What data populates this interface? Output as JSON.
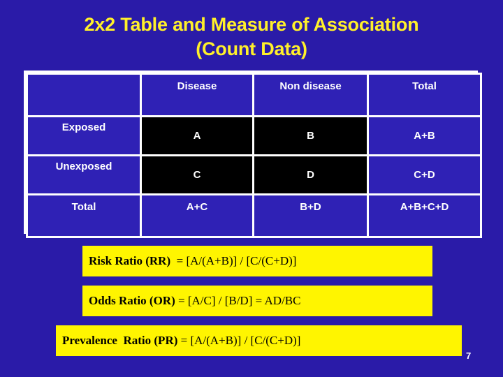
{
  "slide": {
    "title_line1": "2x2 Table and Measure of Association",
    "title_line2": "(Count Data)",
    "page_number": "7",
    "colors": {
      "background": "#2A1BA8",
      "cell_blue": "#2F21B5",
      "cell_black": "#000000",
      "border_white": "#FFFFFF",
      "title_yellow": "#FFF02A",
      "box_yellow": "#FFF500",
      "text_white": "#FFFFFF",
      "text_black": "#000000"
    }
  },
  "table": {
    "columns": [
      "",
      "Disease",
      "Non disease",
      "Total"
    ],
    "rows": [
      {
        "label": "Exposed",
        "disease": "A",
        "non_disease": "B",
        "total": "A+B"
      },
      {
        "label": "Unexposed",
        "disease": "C",
        "non_disease": "D",
        "total": "C+D"
      },
      {
        "label": "Total",
        "disease": "A+C",
        "non_disease": "B+D",
        "total": "A+B+C+D"
      }
    ]
  },
  "formulas": [
    {
      "lead": "Risk Ratio (RR) ",
      "rest": " = [A/(A+B)] / [C/(C+D)]"
    },
    {
      "lead": "Odds Ratio (OR)",
      "rest": " = [A/C] / [B/D] = AD/BC"
    },
    {
      "lead": "Prevalence  Ratio (PR)",
      "rest": " = [A/(A+B)] / [C/(C+D)]"
    }
  ]
}
